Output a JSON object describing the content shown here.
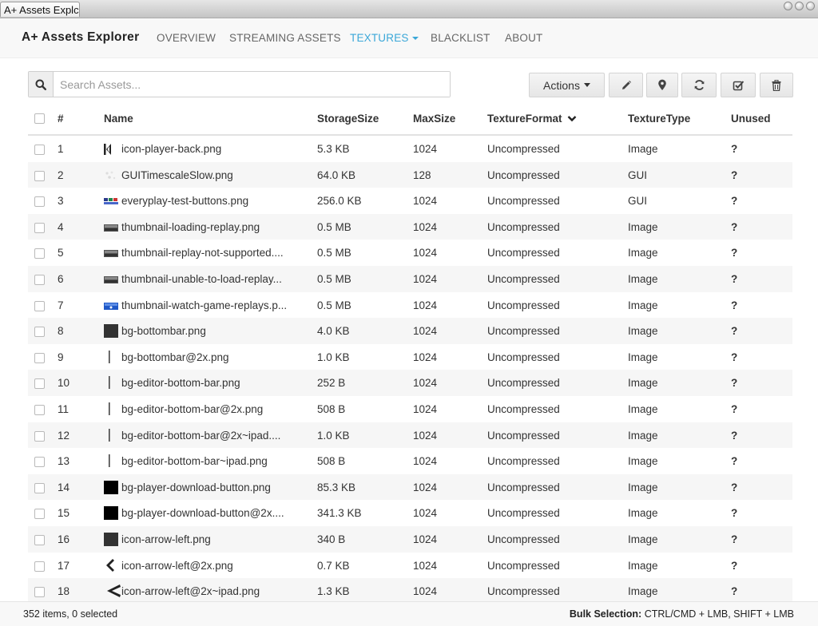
{
  "window": {
    "tab_title": "A+ Assets Explc"
  },
  "nav": {
    "brand": "A+ Assets Explorer",
    "items": [
      {
        "label": "OVERVIEW",
        "active": false
      },
      {
        "label": "STREAMING ASSETS",
        "active": false
      },
      {
        "label": "TEXTURES",
        "active": true
      },
      {
        "label": "BLACKLIST",
        "active": false
      },
      {
        "label": "ABOUT",
        "active": false
      }
    ]
  },
  "search": {
    "placeholder": "Search Assets...",
    "value": ""
  },
  "toolbar": {
    "actions_label": "Actions",
    "buttons": [
      "pencil-icon",
      "map-marker-icon",
      "refresh-icon",
      "check-square-icon",
      "trash-icon"
    ]
  },
  "table": {
    "headers": {
      "index": "#",
      "name": "Name",
      "storage": "StorageSize",
      "maxsize": "MaxSize",
      "format": "TextureFormat",
      "type": "TextureType",
      "unused": "Unused"
    },
    "sort_column": "TextureFormat",
    "rows": [
      {
        "num": "1",
        "name": "icon-player-back.png",
        "storage": "5.3 KB",
        "maxsize": "1024",
        "format": "Uncompressed",
        "type": "Image",
        "unused": "?",
        "thumb": "back"
      },
      {
        "num": "2",
        "name": "GUITimescaleSlow.png",
        "storage": "64.0 KB",
        "maxsize": "128",
        "format": "Uncompressed",
        "type": "GUI",
        "unused": "?",
        "thumb": "faint"
      },
      {
        "num": "3",
        "name": "everyplay-test-buttons.png",
        "storage": "256.0 KB",
        "maxsize": "1024",
        "format": "Uncompressed",
        "type": "GUI",
        "unused": "?",
        "thumb": "buttons"
      },
      {
        "num": "4",
        "name": "thumbnail-loading-replay.png",
        "storage": "0.5 MB",
        "maxsize": "1024",
        "format": "Uncompressed",
        "type": "Image",
        "unused": "?",
        "thumb": "strip"
      },
      {
        "num": "5",
        "name": "thumbnail-replay-not-supported....",
        "storage": "0.5 MB",
        "maxsize": "1024",
        "format": "Uncompressed",
        "type": "Image",
        "unused": "?",
        "thumb": "strip"
      },
      {
        "num": "6",
        "name": "thumbnail-unable-to-load-replay...",
        "storage": "0.5 MB",
        "maxsize": "1024",
        "format": "Uncompressed",
        "type": "Image",
        "unused": "?",
        "thumb": "strip"
      },
      {
        "num": "7",
        "name": "thumbnail-watch-game-replays.p...",
        "storage": "0.5 MB",
        "maxsize": "1024",
        "format": "Uncompressed",
        "type": "Image",
        "unused": "?",
        "thumb": "blue"
      },
      {
        "num": "8",
        "name": "bg-bottombar.png",
        "storage": "4.0 KB",
        "maxsize": "1024",
        "format": "Uncompressed",
        "type": "Image",
        "unused": "?",
        "thumb": "square-dark"
      },
      {
        "num": "9",
        "name": "bg-bottombar@2x.png",
        "storage": "1.0 KB",
        "maxsize": "1024",
        "format": "Uncompressed",
        "type": "Image",
        "unused": "?",
        "thumb": "line"
      },
      {
        "num": "10",
        "name": "bg-editor-bottom-bar.png",
        "storage": "252 B",
        "maxsize": "1024",
        "format": "Uncompressed",
        "type": "Image",
        "unused": "?",
        "thumb": "line"
      },
      {
        "num": "11",
        "name": "bg-editor-bottom-bar@2x.png",
        "storage": "508 B",
        "maxsize": "1024",
        "format": "Uncompressed",
        "type": "Image",
        "unused": "?",
        "thumb": "line"
      },
      {
        "num": "12",
        "name": "bg-editor-bottom-bar@2x~ipad....",
        "storage": "1.0 KB",
        "maxsize": "1024",
        "format": "Uncompressed",
        "type": "Image",
        "unused": "?",
        "thumb": "line"
      },
      {
        "num": "13",
        "name": "bg-editor-bottom-bar~ipad.png",
        "storage": "508 B",
        "maxsize": "1024",
        "format": "Uncompressed",
        "type": "Image",
        "unused": "?",
        "thumb": "line"
      },
      {
        "num": "14",
        "name": "bg-player-download-button.png",
        "storage": "85.3 KB",
        "maxsize": "1024",
        "format": "Uncompressed",
        "type": "Image",
        "unused": "?",
        "thumb": "square-black"
      },
      {
        "num": "15",
        "name": "bg-player-download-button@2x....",
        "storage": "341.3 KB",
        "maxsize": "1024",
        "format": "Uncompressed",
        "type": "Image",
        "unused": "?",
        "thumb": "square-black"
      },
      {
        "num": "16",
        "name": "icon-arrow-left.png",
        "storage": "340 B",
        "maxsize": "1024",
        "format": "Uncompressed",
        "type": "Image",
        "unused": "?",
        "thumb": "square-dark"
      },
      {
        "num": "17",
        "name": "icon-arrow-left@2x.png",
        "storage": "0.7 KB",
        "maxsize": "1024",
        "format": "Uncompressed",
        "type": "Image",
        "unused": "?",
        "thumb": "chevron"
      },
      {
        "num": "18",
        "name": "icon-arrow-left@2x~ipad.png",
        "storage": "1.3 KB",
        "maxsize": "1024",
        "format": "Uncompressed",
        "type": "Image",
        "unused": "?",
        "thumb": "chevron-big"
      }
    ]
  },
  "status": {
    "summary": "352 items, 0 selected",
    "bulk_label": "Bulk Selection:",
    "bulk_keys": "CTRL/CMD + LMB, SHIFT + LMB"
  },
  "colors": {
    "accent": "#3aa7d8",
    "stripe": "#f6f6f6"
  }
}
